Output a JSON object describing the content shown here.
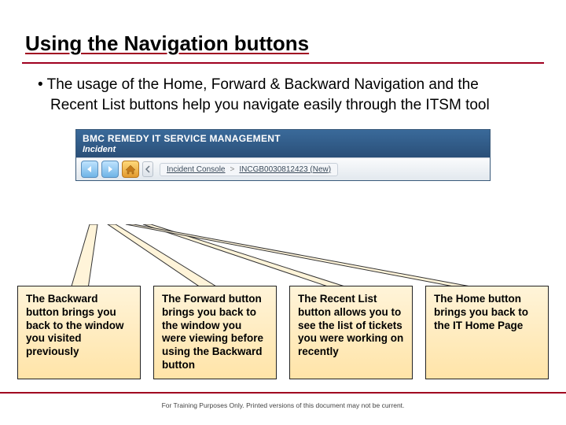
{
  "title": "Using the Navigation buttons",
  "bullet": "The usage of the Home, Forward & Backward Navigation and the Recent List buttons help you navigate easily through the ITSM tool",
  "app": {
    "header_title": "BMC REMEDY IT SERVICE MANAGEMENT",
    "header_sub": "Incident",
    "breadcrumb_link": "Incident Console",
    "breadcrumb_sep": ">",
    "breadcrumb_text": "INCGB0030812423 (New)"
  },
  "callouts": [
    "The Backward button brings you back to the window you visited previously",
    "The Forward button brings you back to the window you were viewing before using the Backward button",
    "The Recent List button allows you to see the list of tickets you were working on recently",
    "The Home button brings you back to the IT Home Page"
  ],
  "footnote": "For Training Purposes Only. Printed versions of this document may not be current."
}
